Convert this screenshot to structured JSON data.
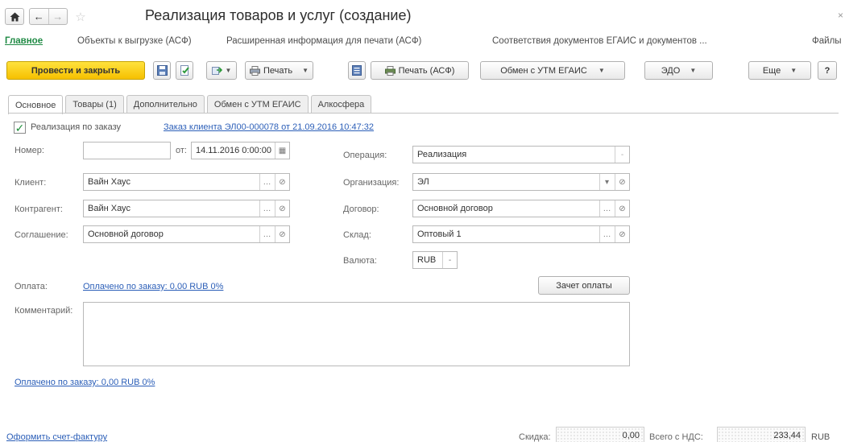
{
  "window": {
    "title": "Реализация товаров и услуг (создание)",
    "close_glyph": "×"
  },
  "nav": {
    "home_icon": "home-icon",
    "back_icon": "←",
    "forward_icon": "→"
  },
  "panel_links": [
    "Главное",
    "Объекты к выгрузке (АСФ)",
    "Расширенная информация для печати (АСФ)",
    "Соответствия документов ЕГАИС и документов ...",
    "Файлы"
  ],
  "toolbar": {
    "post_close": "Провести и закрыть",
    "print": "Печать",
    "print_asf": "Печать (АСФ)",
    "egais": "Обмен с УТМ ЕГАИС",
    "edo": "ЭДО",
    "more": "Еще",
    "help": "?"
  },
  "tabs": [
    "Основное",
    "Товары (1)",
    "Дополнительно",
    "Обмен с УТМ ЕГАИС",
    "Алкосфера"
  ],
  "form": {
    "by_order_label": "Реализация по заказу",
    "by_order_checked": true,
    "order_link": "Заказ клиента ЭЛ00-000078 от 21.09.2016 10:47:32",
    "number_label": "Номер:",
    "number_value": "",
    "from_label": "от:",
    "date_value": "14.11.2016  0:00:00",
    "client_label": "Клиент:",
    "client_value": "Вайн Хаус",
    "counterparty_label": "Контрагент:",
    "counterparty_value": "Вайн Хаус",
    "agreement_label": "Соглашение:",
    "agreement_value": "Основной договор",
    "operation_label": "Операция:",
    "operation_value": "Реализация",
    "organization_label": "Организация:",
    "organization_value": "ЭЛ",
    "contract_label": "Договор:",
    "contract_value": "Основной договор",
    "warehouse_label": "Склад:",
    "warehouse_value": "Оптовый 1",
    "currency_label": "Валюта:",
    "currency_value": "RUB",
    "payment_label": "Оплата:",
    "payment_link": "Оплачено по заказу: 0,00 RUB  0%",
    "offset_button": "Зачет оплаты",
    "comment_label": "Комментарий:",
    "comment_value": "",
    "paid_link_bottom": "Оплачено по заказу: 0,00 RUB  0%"
  },
  "footer": {
    "invoice_link": "Оформить счет-фактуру",
    "discount_label": "Скидка:",
    "discount_value": "0,00",
    "total_label": "Всего с НДС:",
    "total_value": "233,44",
    "currency": "RUB"
  }
}
